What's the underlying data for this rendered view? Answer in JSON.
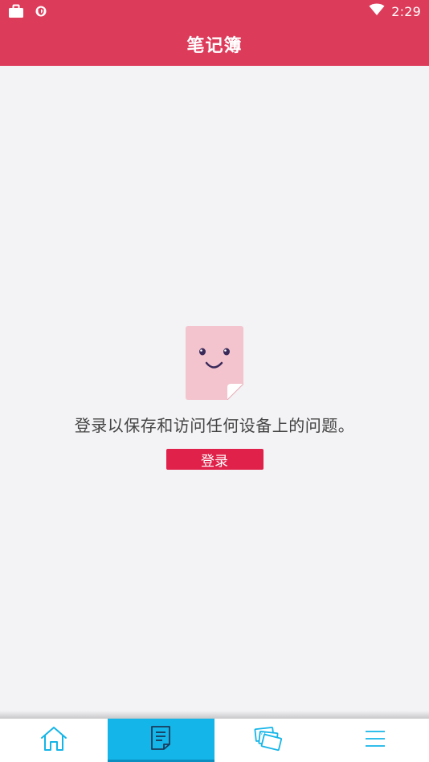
{
  "status_bar": {
    "time": "2:29",
    "icons": [
      "briefcase-icon",
      "shield-icon",
      "wifi-icon"
    ]
  },
  "header": {
    "title": "笔记簿"
  },
  "empty_state": {
    "illustration": "smiling-document-icon",
    "message": "登录以保存和访问任何设备上的问题。",
    "login_button_label": "登录"
  },
  "bottom_nav": {
    "items": [
      {
        "icon": "home-icon",
        "active": false
      },
      {
        "icon": "notebook-icon",
        "active": true
      },
      {
        "icon": "flashcards-icon",
        "active": false
      },
      {
        "icon": "menu-icon",
        "active": false
      }
    ]
  },
  "colors": {
    "header": "#dd3b5a",
    "button": "#e0224a",
    "nav_active": "#14b5e8",
    "nav_icon": "#14b5e8",
    "background": "#f3f2f5"
  }
}
